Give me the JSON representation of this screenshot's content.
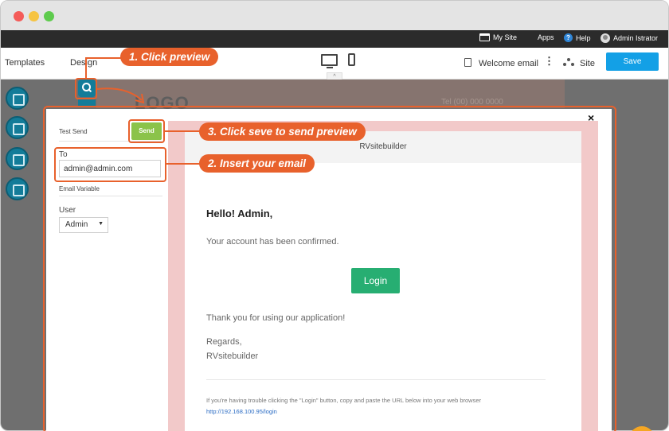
{
  "window": {
    "colors": {
      "close": "#f45b58",
      "minimize": "#f6c443",
      "maximize": "#5ecb4d"
    }
  },
  "topnav": {
    "items": [
      {
        "label": "My Site",
        "icon": "browser-window-icon"
      },
      {
        "label": "Apps",
        "icon": "grid-icon"
      },
      {
        "label": "Help",
        "icon": "help-icon"
      },
      {
        "label": "Admin Istrator",
        "icon": "user-avatar-icon"
      }
    ]
  },
  "toolbar": {
    "templates_label": "Templates",
    "design_label": "Design",
    "template_name": "Welcome email",
    "site_label": "Site",
    "save_label": "Save",
    "accent": "#13a0e6"
  },
  "canvas": {
    "logo_text": "LOGO",
    "phone_text": "Tel (00) 000 0000"
  },
  "test_send": {
    "heading": "Test Send",
    "send_label": "Send",
    "to_label": "To",
    "to_value": "admin@admin.com",
    "variables_label": "Email Variable",
    "user_label": "User",
    "user_selected": "Admin",
    "send_color": "#8bc34a"
  },
  "email": {
    "header": "RVsitebuilder",
    "greeting": "Hello! Admin,",
    "confirm_text": "Your account has been confirmed.",
    "button_label": "Login",
    "button_color": "#27ae72",
    "thanks": "Thank you for using our application!",
    "regards": "Regards,",
    "signature": "RVsitebuilder",
    "trouble_text": "If you're having trouble clicking the \"Login\" button, copy and paste the URL below into your web browser",
    "url": "http://192.168.100.95/login"
  },
  "annotations": {
    "step1": "1. Click preview",
    "step2": "2. Insert your email",
    "step3": "3. Click seve to send preview",
    "color": "#e8612c"
  },
  "modal": {
    "close_glyph": "×"
  }
}
